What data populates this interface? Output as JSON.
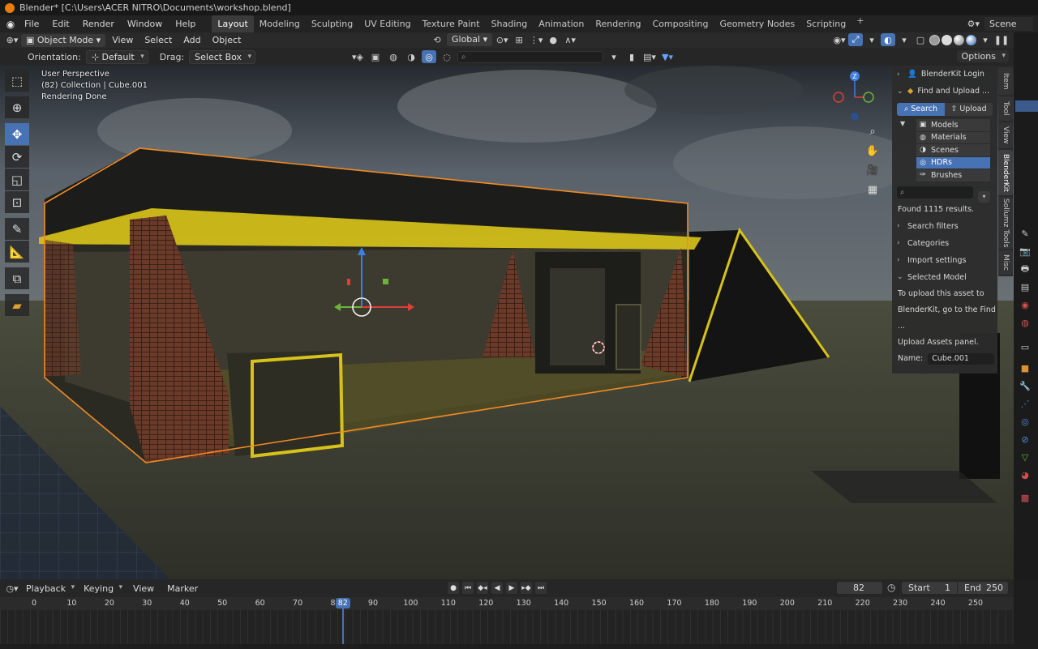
{
  "window": {
    "title": "Blender* [C:\\Users\\ACER NITRO\\Documents\\workshop.blend]"
  },
  "menu": {
    "items": [
      "File",
      "Edit",
      "Render",
      "Window",
      "Help"
    ],
    "workspaces": [
      "Layout",
      "Modeling",
      "Sculpting",
      "UV Editing",
      "Texture Paint",
      "Shading",
      "Animation",
      "Rendering",
      "Compositing",
      "Geometry Nodes",
      "Scripting"
    ],
    "active_workspace": "Layout",
    "scene_name": "Scene"
  },
  "viewport_header": {
    "mode": "Object Mode",
    "menus": [
      "View",
      "Select",
      "Add",
      "Object"
    ],
    "transform_orientation": "Global"
  },
  "tool_header": {
    "orientation_label": "Orientation:",
    "orientation_value": "Default",
    "drag_label": "Drag:",
    "drag_value": "Select Box",
    "options_label": "Options"
  },
  "viewport": {
    "overlay_lines": [
      "User Perspective",
      "(82) Collection | Cube.001",
      "Rendering Done"
    ],
    "gizmo_axes": [
      "Z",
      "X",
      "Y"
    ]
  },
  "blenderkit": {
    "login_label": "BlenderKit Login",
    "find_upload_label": "Find and Upload ...",
    "tabs": [
      "Search",
      "Upload"
    ],
    "active_tab": "Search",
    "categories": [
      {
        "label": "Models",
        "icon": "cube-icon"
      },
      {
        "label": "Materials",
        "icon": "material-icon"
      },
      {
        "label": "Scenes",
        "icon": "scene-icon"
      },
      {
        "label": "HDRs",
        "icon": "world-icon"
      },
      {
        "label": "Brushes",
        "icon": "brush-icon"
      }
    ],
    "selected_category": "HDRs",
    "results_text": "Found 1115 results.",
    "sections": [
      "Search filters",
      "Categories",
      "Import settings"
    ],
    "selected_model_label": "Selected Model",
    "upload_hint": [
      "To upload this asset to",
      "BlenderKit, go to the Find ...",
      "Upload Assets panel."
    ],
    "name_label": "Name:",
    "name_value": "Cube.001"
  },
  "sidebar_tabs": [
    "Item",
    "Tool",
    "View",
    "BlenderKit",
    "Sollumz Tools",
    "Misc"
  ],
  "active_sidebar_tab": "BlenderKit",
  "timeline": {
    "menus": [
      "Playback",
      "Keying",
      "View",
      "Marker"
    ],
    "current_frame": "82",
    "start_label": "Start",
    "start_value": "1",
    "end_label": "End",
    "end_value": "250",
    "ticks": [
      "0",
      "10",
      "20",
      "30",
      "40",
      "50",
      "60",
      "70",
      "80",
      "90",
      "100",
      "110",
      "120",
      "130",
      "140",
      "150",
      "160",
      "170",
      "180",
      "190",
      "200",
      "210",
      "220",
      "230",
      "240",
      "250"
    ]
  },
  "colors": {
    "accent": "#4772b3",
    "selection_outline": "#f08a24",
    "active_yellow": "#d6c21a"
  }
}
